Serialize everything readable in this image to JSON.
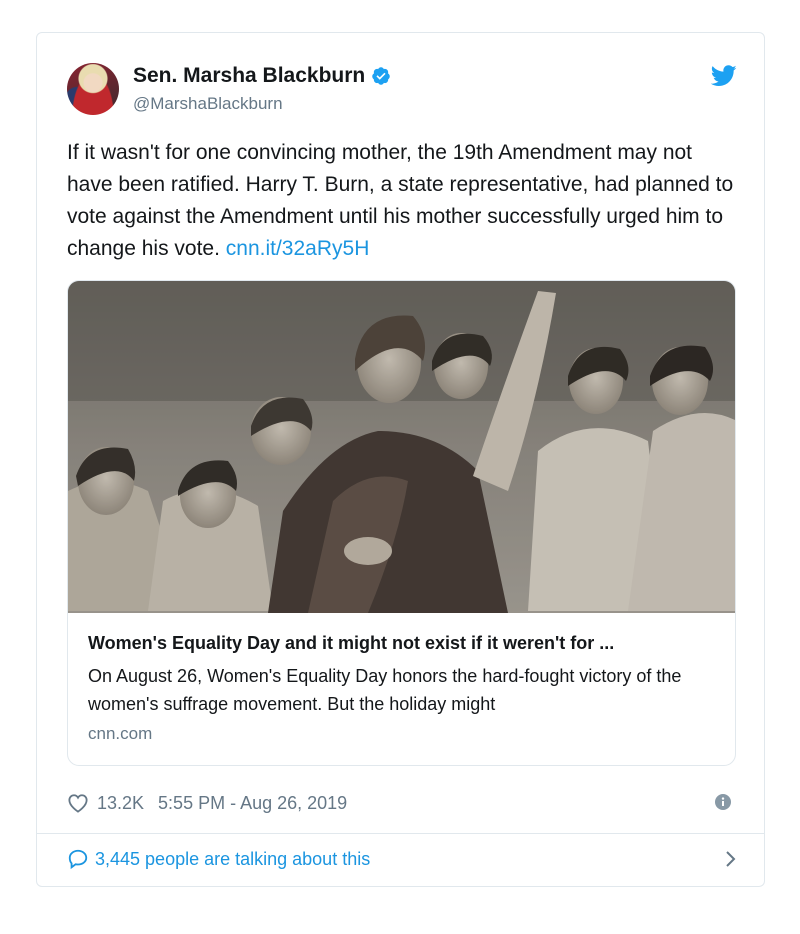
{
  "author": {
    "display_name": "Sen. Marsha Blackburn",
    "handle": "@MarshaBlackburn",
    "verified": true
  },
  "tweet": {
    "text": "If it wasn't for one convincing mother, the 19th Amendment may not have been ratified. Harry T. Burn, a state representative, had planned to vote against the Amendment until his mother successfully urged him to change his vote.",
    "link_text": "cnn.it/32aRy5H"
  },
  "card": {
    "title": "Women's Equality Day and it might not exist if it weren't for ...",
    "description": "On August 26, Women's Equality Day honors the hard-fought victory of the women's suffrage movement. But the holiday might",
    "domain": "cnn.com"
  },
  "meta": {
    "likes": "13.2K",
    "timestamp": "5:55 PM - Aug 26, 2019"
  },
  "conversation": {
    "label": "3,445 people are talking about this"
  },
  "colors": {
    "link_blue": "#1b95e0",
    "verified_blue": "#1da1f2",
    "muted_gray": "#657786",
    "border": "#e1e8ed"
  },
  "icons": [
    "verified-badge-icon",
    "twitter-bird-icon",
    "heart-icon",
    "info-icon",
    "speech-bubble-icon",
    "chevron-right-icon"
  ]
}
